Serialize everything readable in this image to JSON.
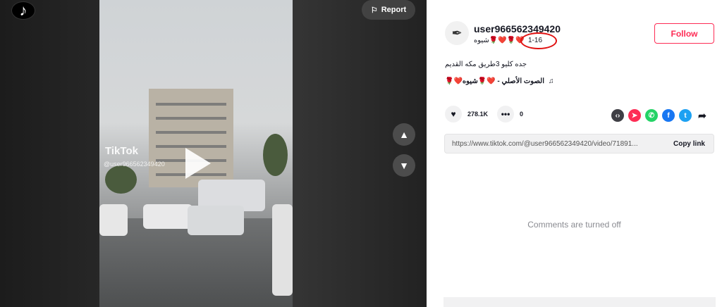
{
  "player": {
    "logo_glyph": "♪",
    "report_label": "Report",
    "watermark_brand": "TikTok",
    "watermark_user": "@user966562349420",
    "up_icon": "chevron-up-icon",
    "down_icon": "chevron-down-icon"
  },
  "author": {
    "username": "user966562349420",
    "nickname": "❤️🌹❤️🌹شيوه",
    "date": "1-16",
    "follow_label": "Follow"
  },
  "post": {
    "caption": "جده كليو 3طريق مكه القديم",
    "music": "🌹❤️الصوت الأصلي - ❤️🌹شيوه"
  },
  "stats": {
    "likes": "278.1K",
    "comments": "0"
  },
  "share": {
    "link": "https://www.tiktok.com/@user966562349420/video/71891...",
    "copy_label": "Copy link"
  },
  "comments_status": "Comments are turned off",
  "colors": {
    "accent": "#fe2c55",
    "annotation": "#e01010"
  }
}
